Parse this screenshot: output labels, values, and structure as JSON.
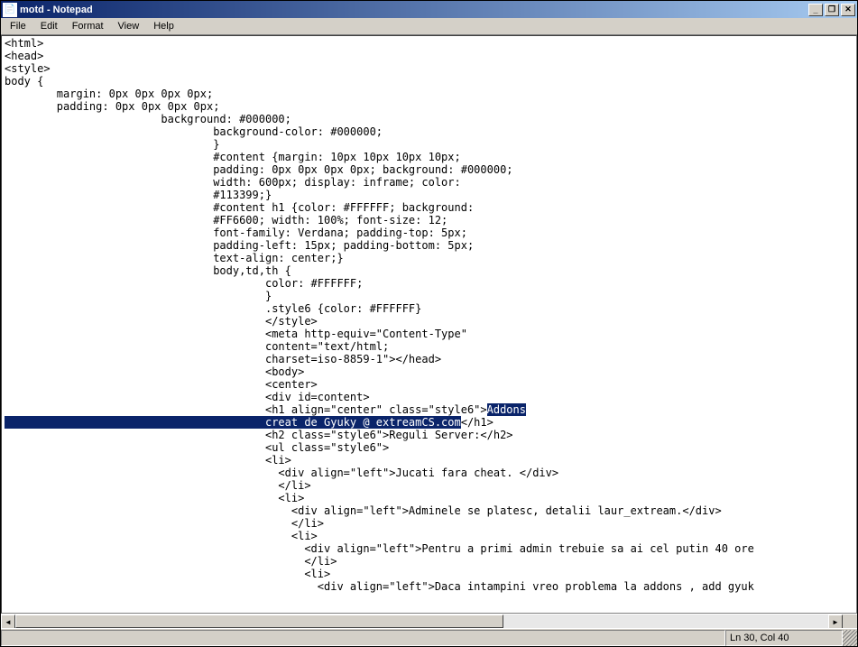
{
  "window": {
    "title": "motd - Notepad",
    "icon_glyph": "📄"
  },
  "controls": {
    "min": "_",
    "max": "❐",
    "close": "✕"
  },
  "menu": {
    "file": "File",
    "edit": "Edit",
    "format": "Format",
    "view": "View",
    "help": "Help"
  },
  "scroll": {
    "left": "◄",
    "right": "►"
  },
  "status": {
    "position": "Ln 30, Col 40"
  },
  "content": {
    "lines": [
      "<html>",
      "<head>",
      "<style>",
      "body {",
      "        margin: 0px 0px 0px 0px;",
      "        padding: 0px 0px 0px 0px;",
      "                        background: #000000;",
      "                                background-color: #000000;",
      "                                }",
      "                                #content {margin: 10px 10px 10px 10px;",
      "                                padding: 0px 0px 0px 0px; background: #000000;",
      "                                width: 600px; display: inframe; color:",
      "                                #113399;}",
      "                                #content h1 {color: #FFFFFF; background:",
      "                                #FF6600; width: 100%; font-size: 12;",
      "                                font-family: Verdana; padding-top: 5px;",
      "                                padding-left: 15px; padding-bottom: 5px;",
      "                                text-align: center;}",
      "                                body,td,th {",
      "                                        color: #FFFFFF;",
      "                                        }",
      "                                        .style6 {color: #FFFFFF}",
      "                                        </style>",
      "                                        <meta http-equiv=\"Content-Type\"",
      "                                        content=\"text/html;",
      "                                        charset=iso-8859-1\"></head>",
      "                                        <body>",
      "                                        <center>",
      "                                        <div id=content>"
    ],
    "sel_line1_pre": "                                        <h1 align=\"center\" class=\"style6\">",
    "sel_line1_sel": "Addons",
    "sel_line2_sel": "                                        creat de Gyuky @ extreamCS.com",
    "sel_line2_post": "</h1>",
    "lines_after": [
      "                                        <h2 class=\"style6\">Reguli Server:</h2>",
      "                                        <ul class=\"style6\">",
      "                                        <li>",
      "                                          <div align=\"left\">Jucati fara cheat. </div>",
      "                                          </li>",
      "                                          <li>",
      "                                            <div align=\"left\">Adminele se platesc, detalii laur_extream.</div>",
      "                                            </li>",
      "                                            <li>",
      "                                              <div align=\"left\">Pentru a primi admin trebuie sa ai cel putin 40 ore ",
      "                                              </li>",
      "                                              <li>",
      "                                                <div align=\"left\">Daca intampini vreo problema la addons , add gyuk"
    ]
  }
}
